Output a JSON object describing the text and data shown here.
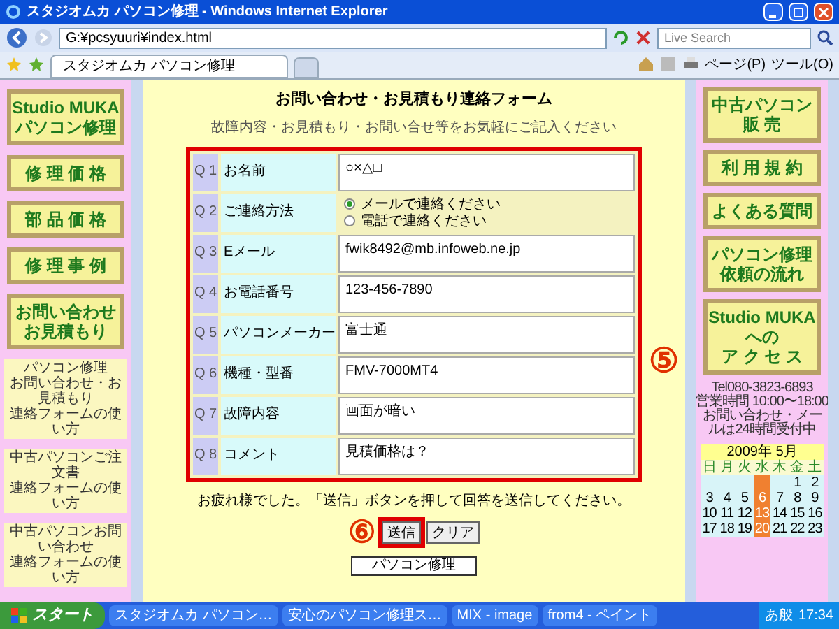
{
  "window": {
    "title": "スタジオムカ パソコン修理 - Windows Internet Explorer"
  },
  "address_bar": {
    "value": "G:¥pcsyuuri¥index.html"
  },
  "search": {
    "placeholder": "Live Search"
  },
  "tabs": [
    {
      "label": "スタジオムカ パソコン修理",
      "selected": true
    }
  ],
  "toolbar": {
    "items": [
      "ページ(P)",
      "ツール(O)"
    ]
  },
  "left_sidebar": {
    "buttons": [
      {
        "lines": [
          "Studio MUKA",
          "パソコン修理"
        ]
      },
      {
        "lines": [
          "修 理 価 格"
        ]
      },
      {
        "lines": [
          "部 品 価 格"
        ]
      },
      {
        "lines": [
          "修 理 事 例"
        ]
      },
      {
        "lines": [
          "お問い合わせ",
          "お見積もり"
        ]
      }
    ],
    "links": [
      {
        "lines": [
          "パソコン修理",
          "お問い合わせ・お見積もり",
          "連絡フォームの使い方"
        ]
      },
      {
        "lines": [
          "中古パソコンご注文書",
          "連絡フォームの使い方"
        ]
      },
      {
        "lines": [
          "中古パソコンお問い合わせ",
          "連絡フォームの使い方"
        ]
      }
    ]
  },
  "form": {
    "title": "お問い合わせ・お見積もり連絡フォーム",
    "subtitle": "故障内容・お見積もり・お問い合せ等をお気軽にご記入ください",
    "questions": [
      {
        "number": "Q 1",
        "label": "お名前",
        "kind": "text",
        "value": "○×△□"
      },
      {
        "number": "Q 2",
        "label": "ご連絡方法",
        "kind": "radio",
        "options": [
          {
            "label": "メールで連絡ください",
            "selected": true
          },
          {
            "label": "電話で連絡ください",
            "selected": false
          }
        ]
      },
      {
        "number": "Q 3",
        "label": "Eメール",
        "kind": "text",
        "value": "fwik8492@mb.infoweb.ne.jp"
      },
      {
        "number": "Q 4",
        "label": "お電話番号",
        "kind": "text",
        "value": "123-456-7890"
      },
      {
        "number": "Q 5",
        "label": "パソコンメーカー",
        "kind": "text",
        "value": "富士通"
      },
      {
        "number": "Q 6",
        "label": "機種・型番",
        "kind": "text",
        "value": "FMV-7000MT4"
      },
      {
        "number": "Q 7",
        "label": "故障内容",
        "kind": "text",
        "value": "画面が暗い"
      },
      {
        "number": "Q 8",
        "label": "コメント",
        "kind": "text",
        "value": "見積価格は？"
      }
    ],
    "note": "お疲れ様でした。「送信」ボタンを押して回答を送信してください。",
    "buttons": [
      "送信",
      "クリア"
    ],
    "footer_box": "パソコン修理"
  },
  "annotations": [
    "⑤",
    "⑥"
  ],
  "right_sidebar": {
    "buttons": [
      {
        "lines": [
          "中古パソコン",
          "販 売"
        ]
      },
      {
        "lines": [
          "利 用 規 約"
        ]
      },
      {
        "lines": [
          "よくある質問"
        ]
      },
      {
        "lines": [
          "パソコン修理",
          "依頼の流れ"
        ]
      },
      {
        "lines": [
          "Studio MUKA",
          "への",
          "ア ク セ ス"
        ]
      }
    ],
    "contact": [
      "Tel080-3823-6893",
      "営業時間 10:00〜18:00",
      "お問い合わせ・メー",
      "ルは24時間受付中"
    ]
  },
  "calendar": {
    "title": "2009年 5月",
    "weekdays": [
      "日",
      "月",
      "火",
      "水",
      "木",
      "金",
      "土"
    ],
    "weeks": [
      [
        {
          "highlighted": false
        },
        {
          "highlighted": false
        },
        {
          "highlighted": false
        },
        {
          "highlighted": true
        },
        {
          "highlighted": false
        },
        {
          "day": "1",
          "highlighted": false
        },
        {
          "day": "2",
          "highlighted": false
        }
      ],
      [
        {
          "day": "3",
          "highlighted": false
        },
        {
          "day": "4",
          "highlighted": false
        },
        {
          "day": "5",
          "highlighted": false
        },
        {
          "day": "6",
          "highlighted": true
        },
        {
          "day": "7",
          "highlighted": false
        },
        {
          "day": "8",
          "highlighted": false
        },
        {
          "day": "9",
          "highlighted": false
        }
      ],
      [
        {
          "day": "10",
          "highlighted": false
        },
        {
          "day": "11",
          "highlighted": false
        },
        {
          "day": "12",
          "highlighted": false
        },
        {
          "day": "13",
          "highlighted": true
        },
        {
          "day": "14",
          "highlighted": false
        },
        {
          "day": "15",
          "highlighted": false
        },
        {
          "day": "16",
          "highlighted": false
        }
      ],
      [
        {
          "day": "17",
          "highlighted": false
        },
        {
          "day": "18",
          "highlighted": false
        },
        {
          "day": "19",
          "highlighted": false
        },
        {
          "day": "20",
          "highlighted": true
        },
        {
          "day": "21",
          "highlighted": false
        },
        {
          "day": "22",
          "highlighted": false
        },
        {
          "day": "23",
          "highlighted": false
        }
      ]
    ]
  },
  "taskbar": {
    "start": "スタート",
    "items": [
      "スタジオムカ パソコン…",
      "安心のパソコン修理ス…",
      "MIX - image",
      "from4 - ペイント"
    ],
    "ime": "あ般",
    "clock": "17:34"
  }
}
